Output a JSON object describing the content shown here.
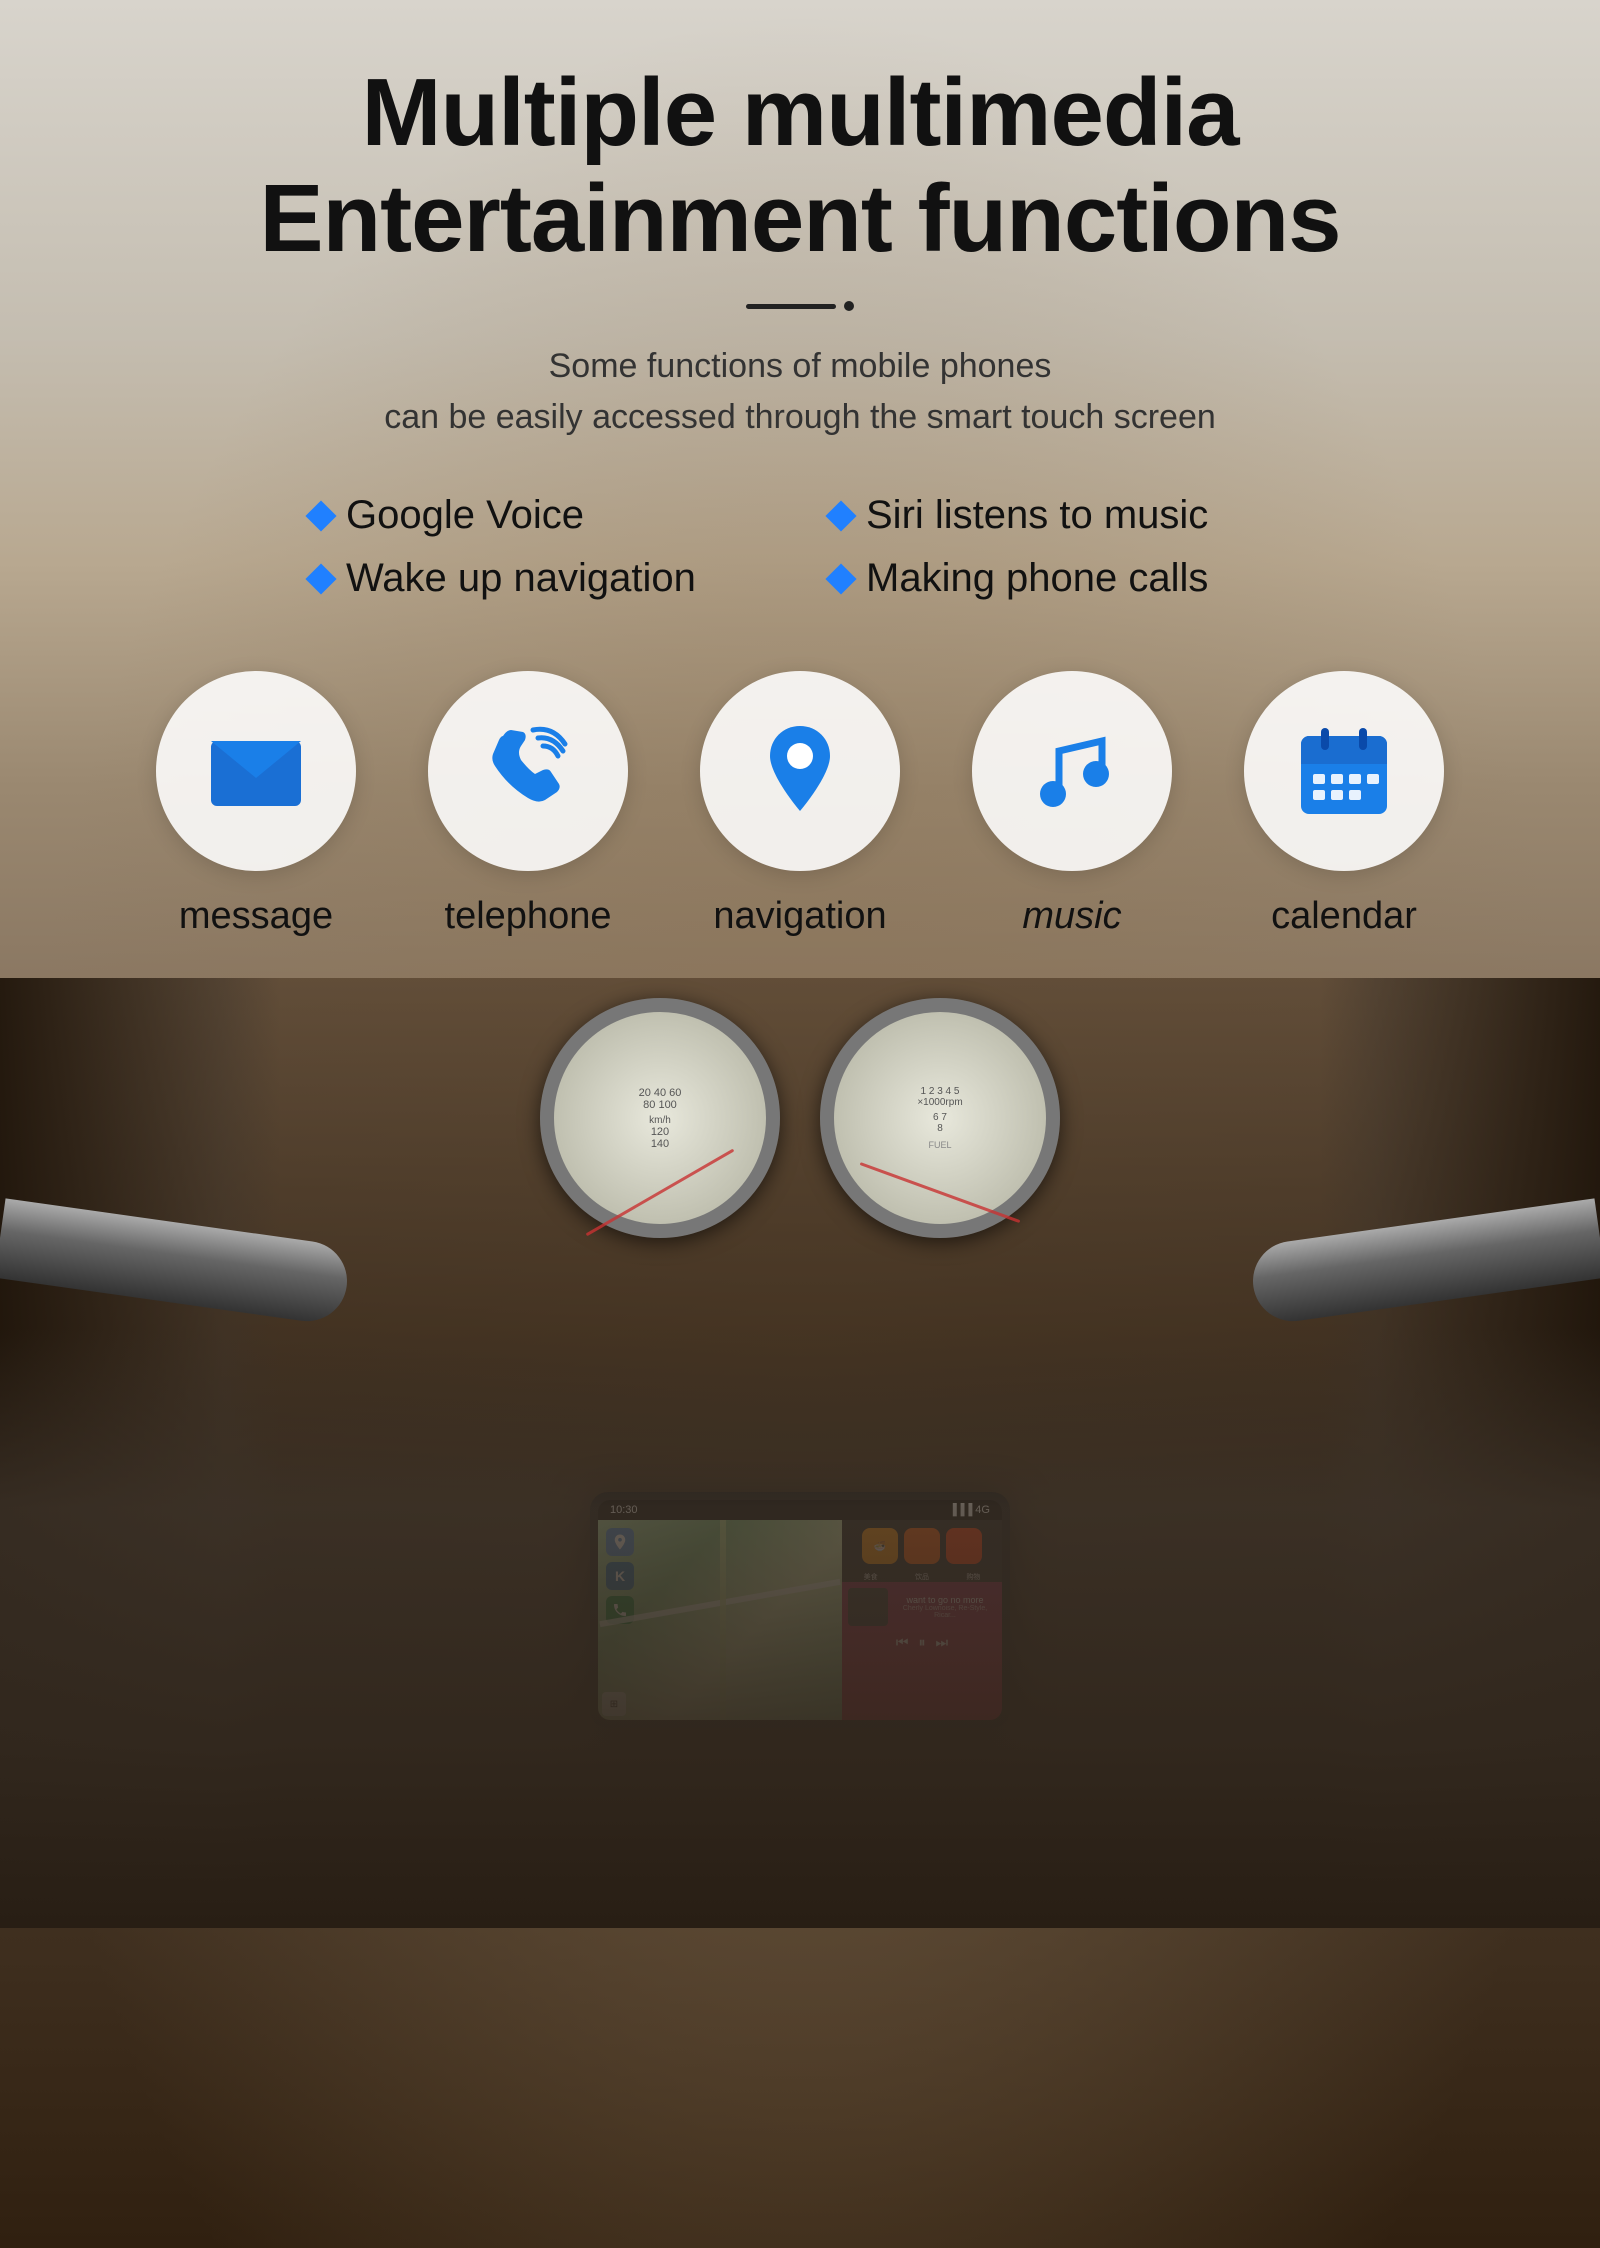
{
  "header": {
    "title_line1": "Multiple multimedia",
    "title_line2": "Entertainment functions"
  },
  "subtitle": {
    "line1": "Some functions of mobile phones",
    "line2": "can be easily accessed through the smart touch screen"
  },
  "features": [
    {
      "label": "Google Voice"
    },
    {
      "label": "Siri listens to music"
    },
    {
      "label": "Wake up navigation"
    },
    {
      "label": "Making phone calls"
    }
  ],
  "icons": [
    {
      "id": "message",
      "label": "message"
    },
    {
      "id": "telephone",
      "label": "telephone"
    },
    {
      "id": "navigation",
      "label": "navigation"
    },
    {
      "id": "music",
      "label": "music"
    },
    {
      "id": "calendar",
      "label": "calendar"
    }
  ],
  "screen": {
    "status_time": "10:30",
    "song_title": "want to go no more",
    "song_artist": "Cherly Lownoise, Re-Style, Ricar...",
    "app_labels": [
      "美食",
      "饮品",
      "购物"
    ]
  }
}
